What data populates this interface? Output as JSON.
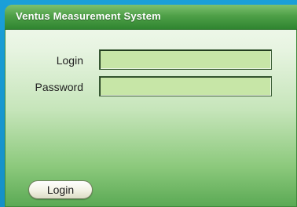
{
  "window": {
    "title": "Ventus Measurement System"
  },
  "form": {
    "login_label": "Login",
    "login_value": "",
    "password_label": "Password",
    "password_value": ""
  },
  "actions": {
    "login_button": "Login"
  },
  "colors": {
    "background": "#1aa0d6",
    "titlebar": "#4fa048",
    "field_fill": "#c7e6a7"
  }
}
